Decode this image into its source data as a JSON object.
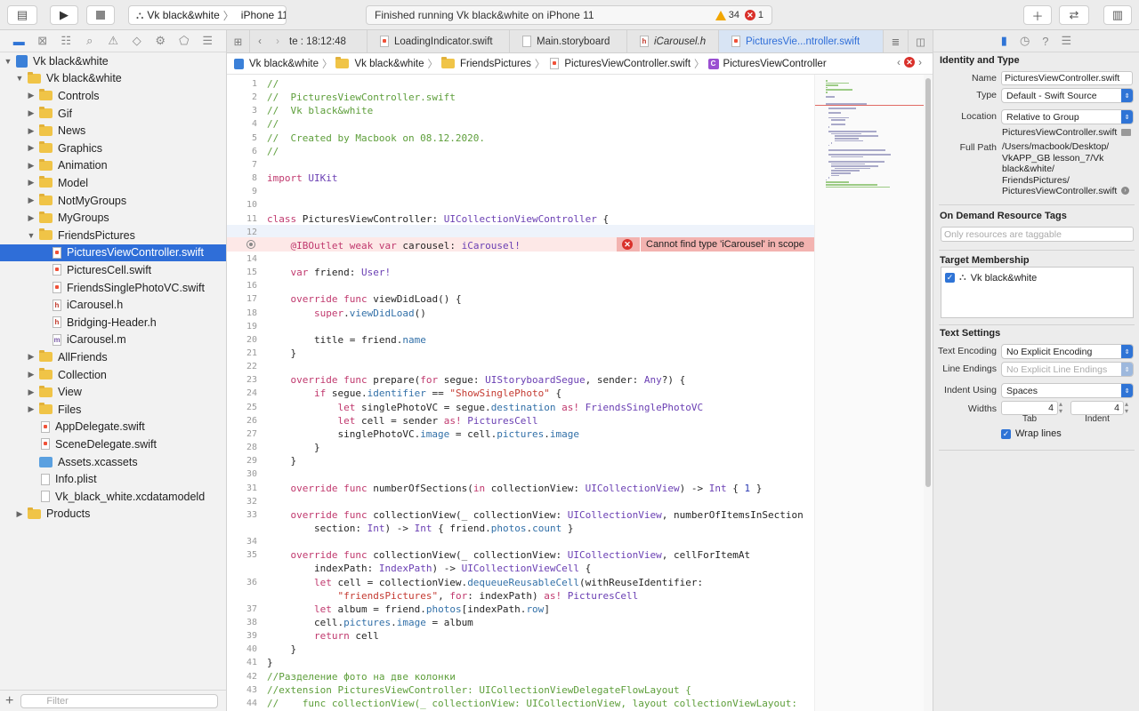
{
  "toolbar": {
    "scheme_target": "Vk black&white",
    "scheme_device": "iPhone 11",
    "activity_text": "Finished running Vk black&white on iPhone 11",
    "warning_count": "34",
    "error_count": "1"
  },
  "navigator": {
    "filter_placeholder": "Filter",
    "rows": [
      {
        "label": "Vk black&white",
        "level": 0,
        "kind": "project",
        "disclosure": "open"
      },
      {
        "label": "Vk black&white",
        "level": 1,
        "kind": "folder",
        "disclosure": "open"
      },
      {
        "label": "Controls",
        "level": 2,
        "kind": "folder",
        "disclosure": "closed"
      },
      {
        "label": "Gif",
        "level": 2,
        "kind": "folder",
        "disclosure": "closed"
      },
      {
        "label": "News",
        "level": 2,
        "kind": "folder",
        "disclosure": "closed"
      },
      {
        "label": "Graphics",
        "level": 2,
        "kind": "folder",
        "disclosure": "closed"
      },
      {
        "label": "Animation",
        "level": 2,
        "kind": "folder",
        "disclosure": "closed"
      },
      {
        "label": "Model",
        "level": 2,
        "kind": "folder",
        "disclosure": "closed"
      },
      {
        "label": "NotMyGroups",
        "level": 2,
        "kind": "folder",
        "disclosure": "closed"
      },
      {
        "label": "MyGroups",
        "level": 2,
        "kind": "folder",
        "disclosure": "closed"
      },
      {
        "label": "FriendsPictures",
        "level": 2,
        "kind": "folder",
        "disclosure": "open"
      },
      {
        "label": "PicturesViewController.swift",
        "level": 3,
        "kind": "swift",
        "selected": true
      },
      {
        "label": "PicturesCell.swift",
        "level": 3,
        "kind": "swift"
      },
      {
        "label": "FriendsSinglePhotoVC.swift",
        "level": 3,
        "kind": "swift"
      },
      {
        "label": "iCarousel.h",
        "level": 3,
        "kind": "h"
      },
      {
        "label": "Bridging-Header.h",
        "level": 3,
        "kind": "h"
      },
      {
        "label": "iCarousel.m",
        "level": 3,
        "kind": "m"
      },
      {
        "label": "AllFriends",
        "level": 2,
        "kind": "folder",
        "disclosure": "closed"
      },
      {
        "label": "Collection",
        "level": 2,
        "kind": "folder",
        "disclosure": "closed"
      },
      {
        "label": "View",
        "level": 2,
        "kind": "folder",
        "disclosure": "closed"
      },
      {
        "label": "Files",
        "level": 2,
        "kind": "folder",
        "disclosure": "closed"
      },
      {
        "label": "AppDelegate.swift",
        "level": 2,
        "kind": "swift"
      },
      {
        "label": "SceneDelegate.swift",
        "level": 2,
        "kind": "swift"
      },
      {
        "label": "Assets.xcassets",
        "level": 2,
        "kind": "asset"
      },
      {
        "label": "Info.plist",
        "level": 2,
        "kind": "plist"
      },
      {
        "label": "Vk_black_white.xcdatamodeld",
        "level": 2,
        "kind": "plist"
      },
      {
        "label": "Products",
        "level": 1,
        "kind": "folder",
        "disclosure": "closed"
      }
    ]
  },
  "tabs": [
    {
      "label": "te : 18:12:48",
      "kind": "none"
    },
    {
      "label": "LoadingIndicator.swift",
      "kind": "swift"
    },
    {
      "label": "Main.storyboard",
      "kind": "plist"
    },
    {
      "label": "iCarousel.h",
      "kind": "h",
      "italic": true
    },
    {
      "label": "PicturesVie...ntroller.swift",
      "kind": "swift",
      "active": true
    }
  ],
  "jumpbar": [
    "Vk black&white",
    "Vk black&white",
    "FriendsPictures",
    "PicturesViewController.swift",
    "PicturesViewController"
  ],
  "editor": {
    "error_message": "Cannot find type 'iCarousel' in scope",
    "lines": [
      {
        "n": "1",
        "t": "//"
      },
      {
        "n": "2",
        "t": "//  PicturesViewController.swift"
      },
      {
        "n": "3",
        "t": "//  Vk black&white"
      },
      {
        "n": "4",
        "t": "//"
      },
      {
        "n": "5",
        "t": "//  Created by Macbook on 08.12.2020."
      },
      {
        "n": "6",
        "t": "//"
      },
      {
        "n": "7",
        "t": ""
      },
      {
        "n": "8",
        "t": "import UIKit"
      },
      {
        "n": "9",
        "t": ""
      },
      {
        "n": "10",
        "t": ""
      },
      {
        "n": "11",
        "t": "class PicturesViewController: UICollectionViewController {"
      },
      {
        "n": "12",
        "t": ""
      },
      {
        "n": "",
        "t": "    @IBOutlet weak var carousel: iCarousel!"
      },
      {
        "n": "14",
        "t": ""
      },
      {
        "n": "15",
        "t": "    var friend: User!"
      },
      {
        "n": "16",
        "t": ""
      },
      {
        "n": "17",
        "t": "    override func viewDidLoad() {"
      },
      {
        "n": "18",
        "t": "        super.viewDidLoad()"
      },
      {
        "n": "19",
        "t": ""
      },
      {
        "n": "20",
        "t": "        title = friend.name"
      },
      {
        "n": "21",
        "t": "    }"
      },
      {
        "n": "22",
        "t": ""
      },
      {
        "n": "23",
        "t": "    override func prepare(for segue: UIStoryboardSegue, sender: Any?) {"
      },
      {
        "n": "24",
        "t": "        if segue.identifier == \"ShowSinglePhoto\" {"
      },
      {
        "n": "25",
        "t": "            let singlePhotoVC = segue.destination as! FriendsSinglePhotoVC"
      },
      {
        "n": "26",
        "t": "            let cell = sender as! PicturesCell"
      },
      {
        "n": "27",
        "t": "            singlePhotoVC.image = cell.pictures.image"
      },
      {
        "n": "28",
        "t": "        }"
      },
      {
        "n": "29",
        "t": "    }"
      },
      {
        "n": "30",
        "t": ""
      },
      {
        "n": "31",
        "t": "    override func numberOfSections(in collectionView: UICollectionView) -> Int { 1 }"
      },
      {
        "n": "32",
        "t": ""
      },
      {
        "n": "33",
        "t": "    override func collectionView(_ collectionView: UICollectionView, numberOfItemsInSection"
      },
      {
        "n": "",
        "t": "        section: Int) -> Int { friend.photos.count }"
      },
      {
        "n": "34",
        "t": ""
      },
      {
        "n": "35",
        "t": "    override func collectionView(_ collectionView: UICollectionView, cellForItemAt"
      },
      {
        "n": "",
        "t": "        indexPath: IndexPath) -> UICollectionViewCell {"
      },
      {
        "n": "36",
        "t": "        let cell = collectionView.dequeueReusableCell(withReuseIdentifier:"
      },
      {
        "n": "",
        "t": "            \"friendsPictures\", for: indexPath) as! PicturesCell"
      },
      {
        "n": "37",
        "t": "        let album = friend.photos[indexPath.row]"
      },
      {
        "n": "38",
        "t": "        cell.pictures.image = album"
      },
      {
        "n": "39",
        "t": "        return cell"
      },
      {
        "n": "40",
        "t": "    }"
      },
      {
        "n": "41",
        "t": "}"
      },
      {
        "n": "42",
        "t": "//Разделение фото на две колонки"
      },
      {
        "n": "43",
        "t": "//extension PicturesViewController: UICollectionViewDelegateFlowLayout {"
      },
      {
        "n": "44",
        "t": "//    func collectionView(_ collectionView: UICollectionView, layout collectionViewLayout:"
      }
    ]
  },
  "inspector": {
    "identity_title": "Identity and Type",
    "name_label": "Name",
    "name_value": "PicturesViewController.swift",
    "type_label": "Type",
    "type_value": "Default - Swift Source",
    "location_label": "Location",
    "location_value": "Relative to Group",
    "location_file": "PicturesViewController.swift",
    "fullpath_label": "Full Path",
    "fullpath_value": "/Users/macbook/Desktop/\nVkAPP_GB  lesson_7/Vk\nblack&white/\nFriendsPictures/\nPicturesViewController.swift",
    "odr_title": "On Demand Resource Tags",
    "odr_placeholder": "Only resources are taggable",
    "target_title": "Target Membership",
    "target_name": "Vk black&white",
    "text_settings_title": "Text Settings",
    "encoding_label": "Text Encoding",
    "encoding_value": "No Explicit Encoding",
    "line_endings_label": "Line Endings",
    "line_endings_value": "No Explicit Line Endings",
    "indent_using_label": "Indent Using",
    "indent_using_value": "Spaces",
    "widths_label": "Widths",
    "tab_value": "4",
    "indent_value": "4",
    "tab_label": "Tab",
    "indent_label": "Indent",
    "wrap_label": "Wrap lines"
  },
  "colors": {
    "accent": "#2f6ed8",
    "error": "#d9302a",
    "warning": "#f1a600",
    "comment": "#5d9e3a",
    "keyword": "#c0396e",
    "type": "#6a3fb3"
  }
}
